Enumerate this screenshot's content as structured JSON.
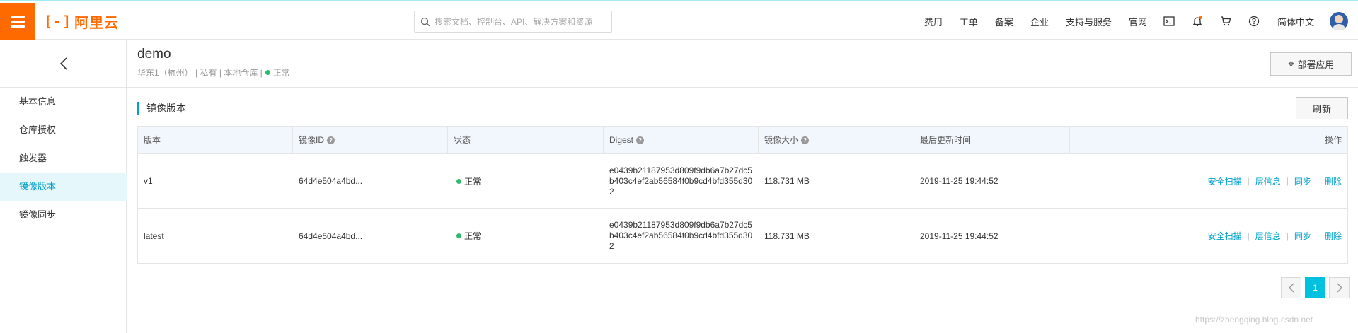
{
  "topbar": {
    "logo_text": "阿里云",
    "search_placeholder": "搜索文档、控制台、API、解决方案和资源",
    "nav": [
      "费用",
      "工单",
      "备案",
      "企业",
      "支持与服务",
      "官网"
    ],
    "language": "简体中文"
  },
  "sidebar": {
    "items": [
      {
        "label": "基本信息"
      },
      {
        "label": "仓库授权"
      },
      {
        "label": "触发器"
      },
      {
        "label": "镜像版本"
      },
      {
        "label": "镜像同步"
      }
    ],
    "active_index": 3
  },
  "header": {
    "title": "demo",
    "region": "华东1（杭州）",
    "visibility": "私有",
    "source": "本地仓库",
    "status": "正常",
    "status_color": "#2fb96a",
    "deploy_label": "部署应用"
  },
  "section": {
    "title": "镜像版本",
    "refresh_label": "刷新"
  },
  "table": {
    "columns": [
      "版本",
      "镜像ID",
      "状态",
      "Digest",
      "镜像大小",
      "最后更新时间",
      "操作"
    ],
    "rows": [
      {
        "version": "v1",
        "image_id": "64d4e504a4bd...",
        "status": "正常",
        "digest": "e0439b21187953d809f9db6a7b27dc5b403c4ef2ab56584f0b9cd4bfd355d302",
        "size": "118.731 MB",
        "updated": "2019-11-25 19:44:52"
      },
      {
        "version": "latest",
        "image_id": "64d4e504a4bd...",
        "status": "正常",
        "digest": "e0439b21187953d809f9db6a7b27dc5b403c4ef2ab56584f0b9cd4bfd355d302",
        "size": "118.731 MB",
        "updated": "2019-11-25 19:44:52"
      }
    ],
    "actions": [
      "安全扫描",
      "层信息",
      "同步",
      "删除"
    ]
  },
  "pagination": {
    "current": "1"
  },
  "watermark": "https://zhengqing.blog.csdn.net",
  "colors": {
    "brand": "#ff6a00",
    "accent": "#00a2ca",
    "active_page": "#00c1de"
  }
}
